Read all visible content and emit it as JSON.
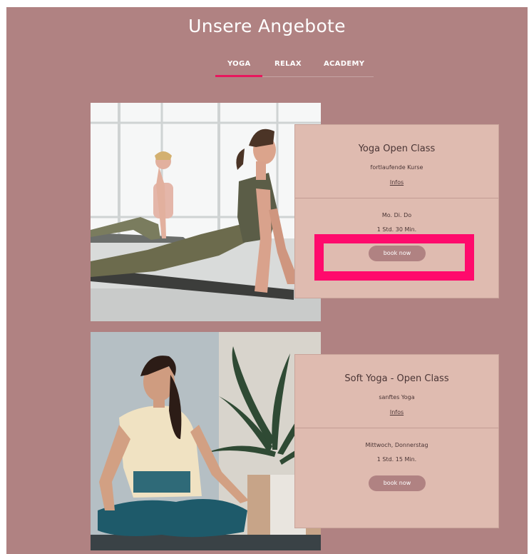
{
  "page": {
    "title": "Unsere Angebote"
  },
  "tabs": [
    {
      "label": "YOGA",
      "active": true
    },
    {
      "label": "RELAX",
      "active": false
    },
    {
      "label": "ACADEMY",
      "active": false
    }
  ],
  "cards": [
    {
      "title": "Yoga Open Class",
      "subtitle": "fortlaufende Kurse",
      "link": "Infos",
      "days": "Mo. Di. Do",
      "duration": "1 Std. 30 Min.",
      "button": "book now"
    },
    {
      "title": "Soft Yoga - Open Class",
      "subtitle": "sanftes Yoga",
      "link": "Infos",
      "days": "Mittwoch, Donnerstag",
      "duration": "1 Std. 15 Min.",
      "button": "book now"
    }
  ],
  "colors": {
    "background": "#b08282",
    "card": "#dfbbb0",
    "accent": "#e8175d",
    "highlight": "#ff0a6c"
  },
  "icons": {
    "photo_1": "yoga-cobra-pose-photo",
    "photo_2": "meditation-lotus-pose-photo"
  }
}
